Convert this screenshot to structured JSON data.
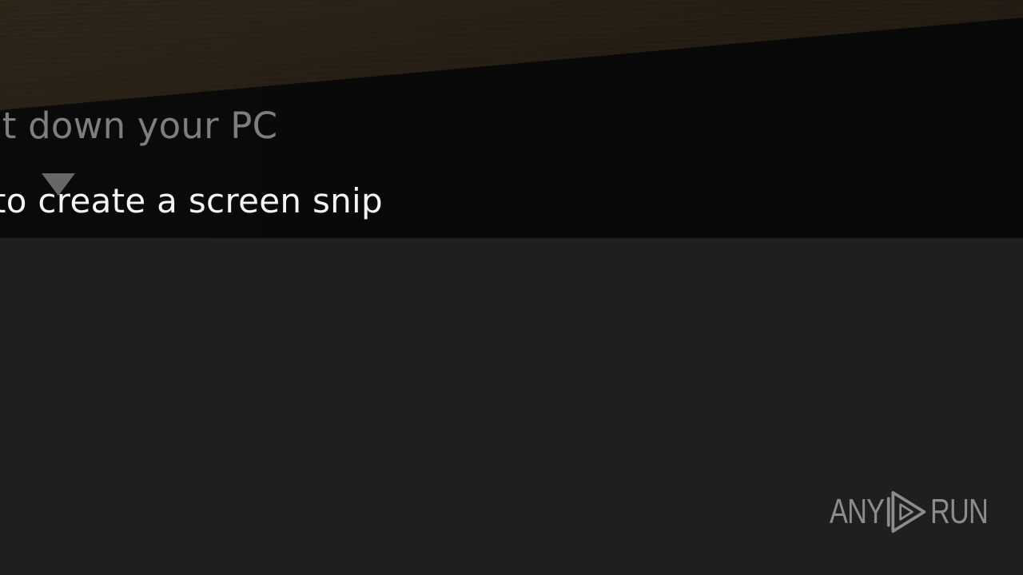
{
  "lockscreen": {
    "shutdown_hint": "ut down your PC",
    "snip_hint": "to create a screen snip"
  },
  "watermark": {
    "left_text": "ANY",
    "right_text": "RUN",
    "icon": "play-icon",
    "color": "#8c8c8c"
  },
  "colors": {
    "background": "#1f1f1f",
    "backdrop": "#0a0a0b",
    "wood": "#2d2418",
    "hint_dim": "#7e7e7e",
    "hint_bright": "#f4f4f4"
  }
}
